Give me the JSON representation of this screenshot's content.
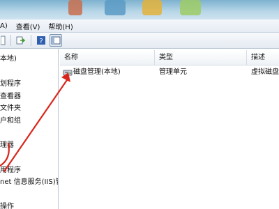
{
  "menubar": {
    "items": [
      "A)",
      "查看(V)",
      "帮助(H)"
    ]
  },
  "toolbar": {
    "icons": [
      "page-icon",
      "divider",
      "export-icon",
      "divider",
      "help-icon",
      "pane-view-icon"
    ]
  },
  "tree": {
    "items": [
      "本地)",
      "划程序",
      "查看器",
      "文件夹",
      "户和组",
      "理器",
      "用程序",
      "net 信息服务(IIS)管",
      "操作"
    ]
  },
  "list": {
    "columns": [
      "名称",
      "类型",
      "描述"
    ],
    "rows": [
      {
        "name": "磁盘管理(本地)",
        "type": "管理单元",
        "description": "虚拟磁盘"
      }
    ]
  },
  "annotation": {
    "color": "#d9261c"
  }
}
